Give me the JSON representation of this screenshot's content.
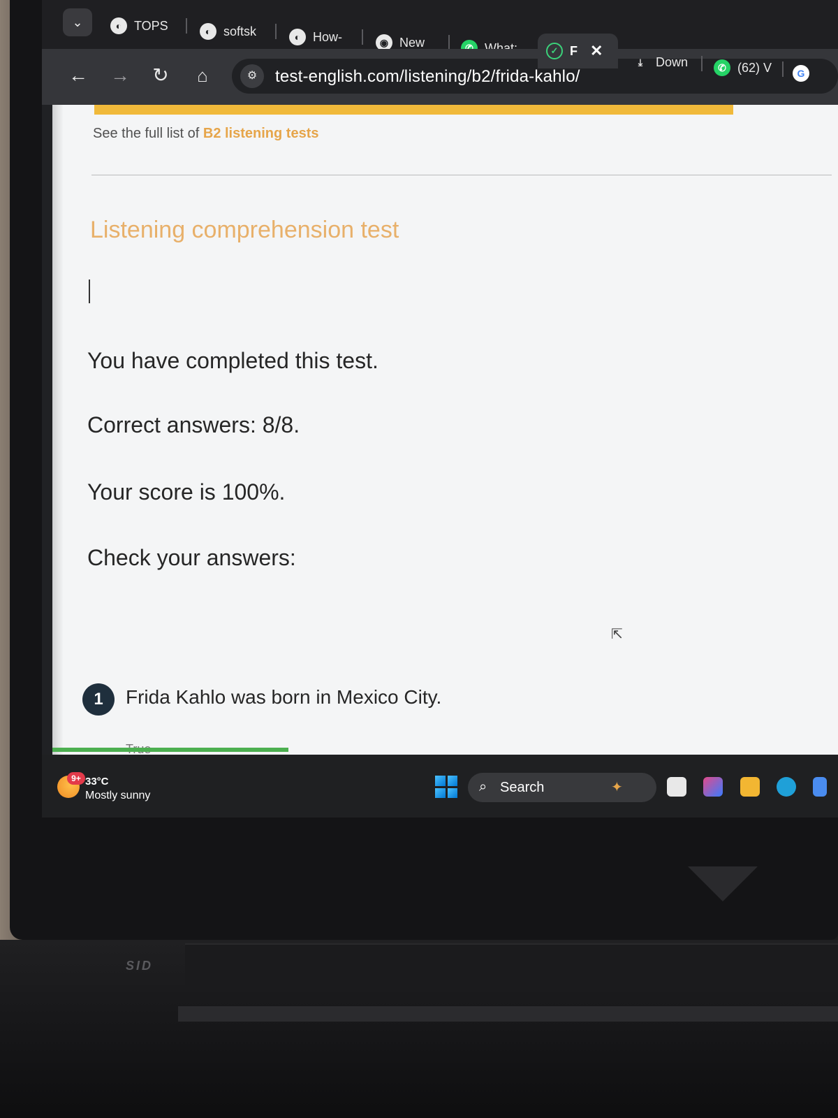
{
  "browser": {
    "tabs": [
      {
        "label": "TOPS",
        "icon": "globe-icon"
      },
      {
        "label": "softsk",
        "icon": "globe-icon"
      },
      {
        "label": "How-",
        "icon": "globe-icon"
      },
      {
        "label": "New",
        "icon": "chrome-icon"
      },
      {
        "label": "What:",
        "icon": "whatsapp-icon"
      },
      {
        "label": "F",
        "icon": "check-circle-icon",
        "active": true
      },
      {
        "label": "Down",
        "icon": "download-icon"
      },
      {
        "label": "(62) V",
        "icon": "whatsapp-icon"
      },
      {
        "label": "",
        "icon": "google-icon"
      }
    ],
    "url": "test-english.com/listening/b2/frida-kahlo/"
  },
  "page": {
    "full_list_prefix": "See the full list of",
    "full_list_link": "B2 listening tests",
    "section_title": "Listening comprehension test",
    "completed_message": "You have completed this test.",
    "correct_answers": "Correct answers: 8/8.",
    "score": "Your score is 100%.",
    "check_answers": "Check your answers:",
    "questions": [
      {
        "number": "1",
        "text": "Frida Kahlo was born in Mexico City.",
        "partial_option": "True"
      }
    ],
    "progress_fraction": 0.3
  },
  "taskbar": {
    "weather_badge": "9+",
    "temperature": "33°C",
    "condition": "Mostly sunny",
    "search_label": "Search"
  },
  "device": {
    "brand_text": "SID"
  },
  "colors": {
    "accent_orange": "#e8b06a",
    "banner_yellow": "#f0b93a",
    "question_badge": "#1f2f3d",
    "progress_green": "#4caf50"
  }
}
